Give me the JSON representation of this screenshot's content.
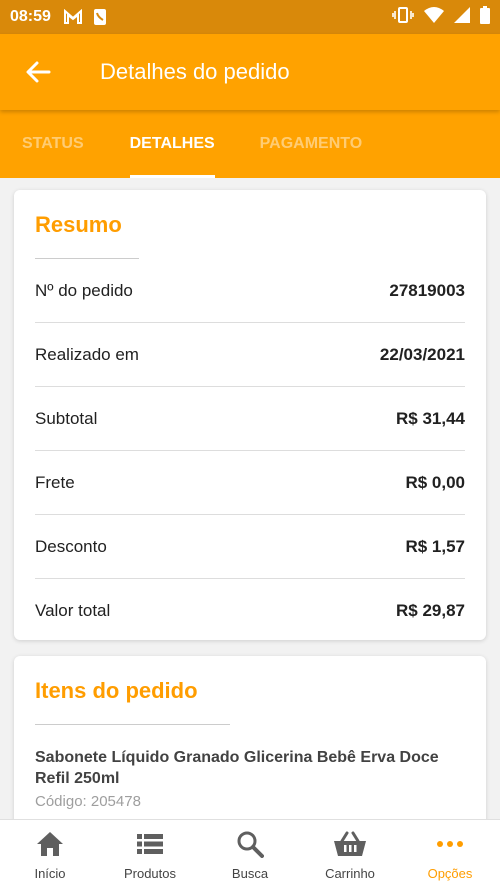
{
  "status_bar": {
    "time": "08:59"
  },
  "app_bar": {
    "title": "Detalhes do pedido"
  },
  "tabs": [
    {
      "label": "STATUS",
      "active": false
    },
    {
      "label": "DETALHES",
      "active": true
    },
    {
      "label": "PAGAMENTO",
      "active": false
    }
  ],
  "resumo": {
    "title": "Resumo",
    "rows": [
      {
        "label": "Nº do pedido",
        "value": "27819003"
      },
      {
        "label": "Realizado em",
        "value": "22/03/2021"
      },
      {
        "label": "Subtotal",
        "value": "R$ 31,44"
      },
      {
        "label": "Frete",
        "value": "R$ 0,00"
      },
      {
        "label": "Desconto",
        "value": "R$ 1,57"
      },
      {
        "label": "Valor total",
        "value": "R$ 29,87"
      }
    ]
  },
  "itens": {
    "title": "Itens do pedido",
    "items": [
      {
        "name": "Sabonete Líquido Granado Glicerina Bebê Erva Doce Refil 250ml",
        "code": "Código: 205478"
      }
    ]
  },
  "bottom_nav": [
    {
      "label": "Início",
      "icon": "home-icon",
      "active": false
    },
    {
      "label": "Produtos",
      "icon": "list-icon",
      "active": false
    },
    {
      "label": "Busca",
      "icon": "search-icon",
      "active": false
    },
    {
      "label": "Carrinho",
      "icon": "basket-icon",
      "active": false
    },
    {
      "label": "Opções",
      "icon": "more-icon",
      "active": true
    }
  ],
  "colors": {
    "primary": "#ffa200",
    "status_bar": "#d9890a",
    "accent_text": "#ff9d00"
  }
}
